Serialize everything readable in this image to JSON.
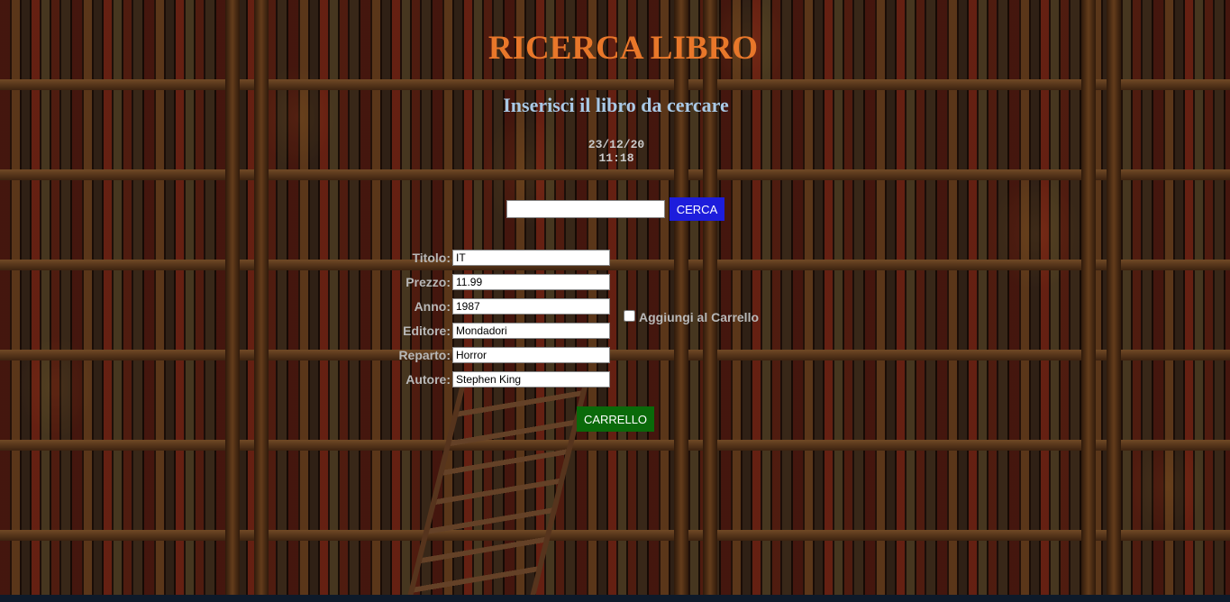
{
  "page": {
    "title": "RICERCA LIBRO",
    "subtitle": "Inserisci il libro da cercare",
    "date": "23/12/20",
    "time": "11:18"
  },
  "search": {
    "value": "",
    "button_label": "CERCA"
  },
  "book_fields": [
    {
      "label": "Titolo:",
      "value": "IT"
    },
    {
      "label": "Prezzo:",
      "value": "11.99"
    },
    {
      "label": "Anno:",
      "value": "1987"
    },
    {
      "label": "Editore:",
      "value": "Mondadori"
    },
    {
      "label": "Reparto:",
      "value": "Horror"
    },
    {
      "label": "Autore:",
      "value": "Stephen King"
    }
  ],
  "cart": {
    "checkbox_label": "Aggiungi al Carrello",
    "checked": false,
    "button_label": "CARRELLO"
  },
  "colors": {
    "title": "#e8772a",
    "subtitle": "#a9c9e6",
    "search_button": "#1d1ddc",
    "cart_button": "#0a6a0a"
  }
}
